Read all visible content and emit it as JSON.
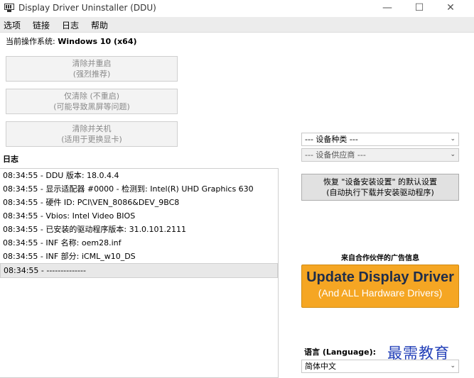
{
  "window": {
    "title": "Display Driver Uninstaller (DDU)",
    "minimize": "—",
    "maximize": "☐",
    "close": "✕"
  },
  "menu": {
    "items": [
      "选项",
      "链接",
      "日志",
      "帮助"
    ]
  },
  "os": {
    "label": "当前操作系统: ",
    "value": "Windows 10 (x64)"
  },
  "actions": {
    "clean_restart": {
      "line1": "清除并重启",
      "line2": "(强烈推荐)"
    },
    "clean_only": {
      "line1": "仅清除 (不重启)",
      "line2": "(可能导致黑屏等问题)"
    },
    "clean_shutdown": {
      "line1": "清除并关机",
      "line2": "(适用于更换显卡)"
    }
  },
  "log": {
    "label": "日志",
    "lines": [
      "08:34:55 - DDU 版本: 18.0.4.4",
      "08:34:55 - 显示适配器 #0000 - 检测到: Intel(R) UHD Graphics 630",
      "08:34:55 - 硬件 ID: PCI\\VEN_8086&DEV_9BC8",
      "08:34:55 - Vbios: Intel Video BIOS",
      "08:34:55 - 已安装的驱动程序版本: 31.0.101.2111",
      "08:34:55 - INF 名称: oem28.inf",
      "08:34:55 - INF 部分: iCML_w10_DS",
      "08:34:55 - --------------"
    ]
  },
  "device_type": {
    "value": "--- 设备种类 ---"
  },
  "device_vendor": {
    "value": "--- 设备供应商 ---"
  },
  "restore": {
    "line1": "恢复 \"设备安装设置\" 的默认设置",
    "line2": "(自动执行下载并安装驱动程序)"
  },
  "ad": {
    "label": "来自合作伙伴的广告信息",
    "title": "Update Display Driver",
    "subtitle": "(And ALL Hardware Drivers)"
  },
  "language": {
    "label": "语言 (Language):",
    "value": "简体中文"
  },
  "watermark": "最需教育"
}
